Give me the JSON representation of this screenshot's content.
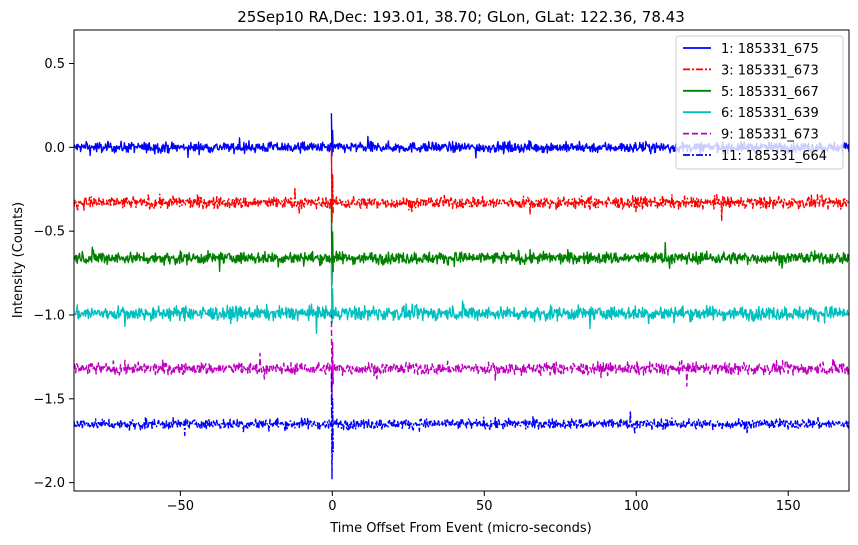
{
  "chart_data": {
    "type": "line",
    "title": "25Sep10 RA,Dec:  193.01,  38.70; GLon, GLat:  122.36,  78.43",
    "xlabel": "Time Offset From Event (micro-seconds)",
    "ylabel": "Intensity (Counts)",
    "xlim": [
      -85,
      170
    ],
    "ylim": [
      -2.05,
      0.7
    ],
    "xticks": [
      -50,
      0,
      50,
      100,
      150
    ],
    "xtick_labels": [
      "−50",
      "0",
      "50",
      "100",
      "150"
    ],
    "yticks": [
      0.5,
      0.0,
      -0.5,
      -1.0,
      -1.5,
      -2.0
    ],
    "ytick_labels": [
      "0.5",
      "0.0",
      "−0.5",
      "−1.0",
      "−1.5",
      "−2.0"
    ],
    "event_x": 0,
    "legend_position": "top-right",
    "grid": false,
    "series": [
      {
        "name": "1: 185331_675",
        "color": "#0000ff",
        "style": "solid",
        "baseline": 0.0,
        "noise": 0.03,
        "event_min": -0.05,
        "event_max": 0.2
      },
      {
        "name": "3: 185331_673",
        "color": "#ff0000",
        "style": "dashdot",
        "baseline": -0.33,
        "noise": 0.035,
        "event_min": -0.45,
        "event_max": -0.0
      },
      {
        "name": "5: 185331_667",
        "color": "#008000",
        "style": "solid",
        "baseline": -0.66,
        "noise": 0.035,
        "event_min": -0.82,
        "event_max": -0.35
      },
      {
        "name": "6: 185331_639",
        "color": "#00bfbf",
        "style": "solid",
        "baseline": -0.99,
        "noise": 0.04,
        "event_min": -1.05,
        "event_max": -0.7
      },
      {
        "name": "9: 185331_673",
        "color": "#bf00bf",
        "style": "dashed",
        "baseline": -1.32,
        "noise": 0.035,
        "event_min": -1.5,
        "event_max": -1.0
      },
      {
        "name": "11: 185331_664",
        "color": "#0000ff",
        "style": "dashdot",
        "baseline": -1.65,
        "noise": 0.03,
        "event_min": -1.98,
        "event_max": -1.35
      }
    ]
  }
}
